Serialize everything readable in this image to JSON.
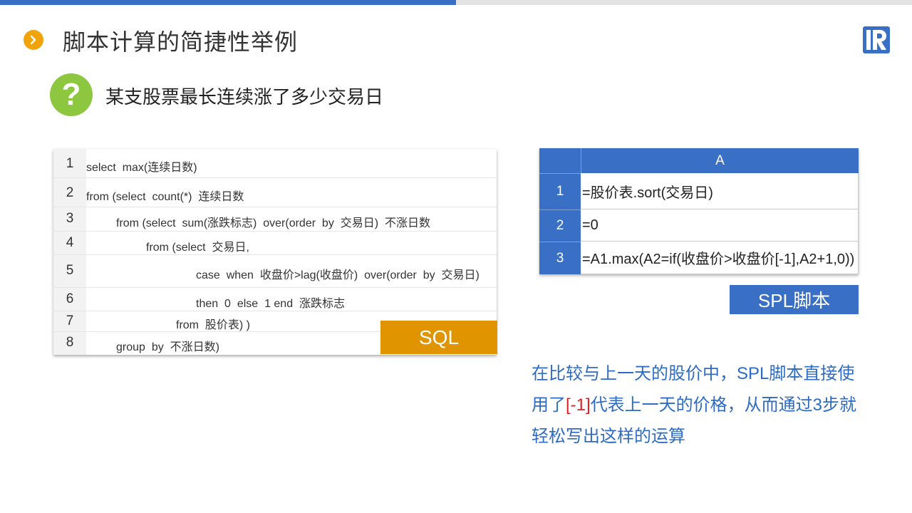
{
  "colors": {
    "accent_blue": "#3a6fc6",
    "sql_orange": "#e09400",
    "bullet_orange": "#f0a30a",
    "question_green": "#8dc63f",
    "highlight_red": "#e02020"
  },
  "header": {
    "title": "脚本计算的简捷性举例",
    "bullet_icon": "chevron-right-icon",
    "logo_icon": "r-logo-icon"
  },
  "question": {
    "icon": "question-mark-icon",
    "mark": "?",
    "text": "某支股票最长连续涨了多少交易日"
  },
  "sql": {
    "tag": "SQL",
    "lines": [
      {
        "num": "1",
        "code": "select  max(连续日数)"
      },
      {
        "num": "2",
        "code": "from (select  count(*)  连续日数"
      },
      {
        "num": "3",
        "code": "from (select  sum(涨跌标志)  over(order  by  交易日)  不涨日数"
      },
      {
        "num": "4",
        "code": "from (select  交易日,"
      },
      {
        "num": "5",
        "code": "case  when  收盘价>lag(收盘价)  over(order  by  交易日)"
      },
      {
        "num": "6",
        "code": "then  0  else  1 end  涨跌标志"
      },
      {
        "num": "7",
        "code": "from  股价表) )"
      },
      {
        "num": "8",
        "code": "group  by  不涨日数)"
      }
    ]
  },
  "spl": {
    "tag": "SPL脚本",
    "column_header": "A",
    "rows": [
      {
        "num": "1",
        "cell": "=股价表.sort(交易日)"
      },
      {
        "num": "2",
        "cell": "=0"
      },
      {
        "num": "3",
        "cell": "=A1.max(A2=if(收盘价>收盘价[-1],A2+1,0))"
      }
    ]
  },
  "note": {
    "part1": "在比较与上一天的股价中，SPL脚本直接使用了",
    "highlight": "[-1]",
    "part2": "代表上一天的价格，从而通过3步就轻松写出这样的运算"
  }
}
